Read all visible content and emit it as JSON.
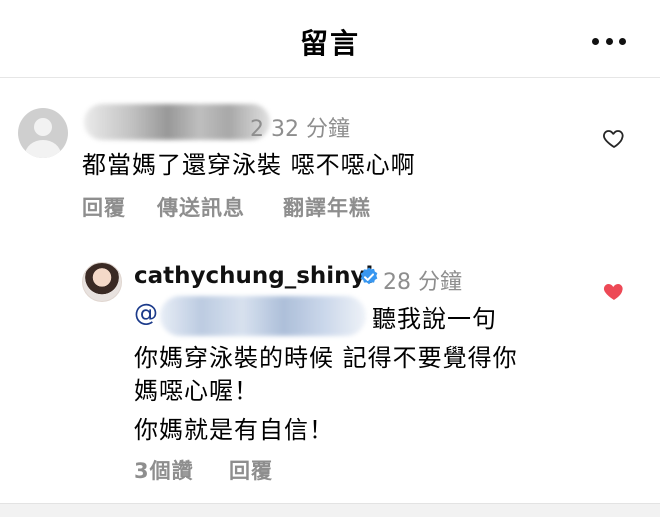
{
  "header": {
    "title": "留言"
  },
  "comments": [
    {
      "time": "2 32 分鐘",
      "text": "都當媽了還穿泳裝 噁不噁心啊",
      "actions": [
        "回覆",
        "傳送訊息",
        "翻譯年糕"
      ]
    },
    {
      "username": "cathychung_shinyi",
      "time": "28 分鐘",
      "mention_prefix": "@",
      "lines": [
        "聽我說一句",
        "你媽穿泳裝的時候 記得不要覺得你",
        "媽噁心喔！",
        "你媽就是有自信！"
      ],
      "likes": "3個讚",
      "reply": "回覆"
    }
  ],
  "colors": {
    "secondary_text": "#8e8e8e",
    "like_red": "#ed4956",
    "verified_blue": "#3897f0"
  },
  "icons": {
    "more": "more-horizontal-icon",
    "heart_outline": "heart-outline-icon",
    "heart_filled": "heart-filled-icon",
    "verified": "verified-badge-icon"
  }
}
